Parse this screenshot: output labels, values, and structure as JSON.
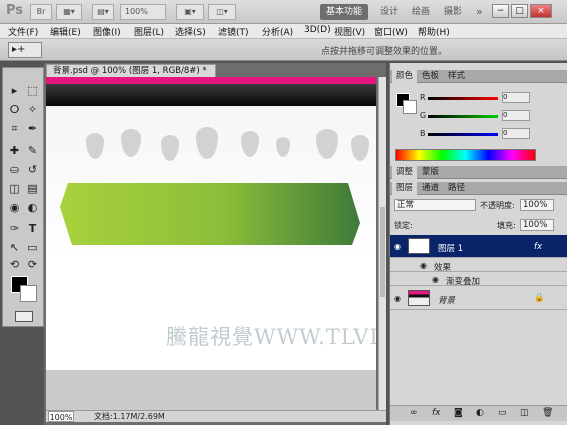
{
  "app": {
    "logo": "Ps",
    "zoom_level": "100%",
    "workspaces": [
      "基本功能",
      "设计",
      "绘画",
      "摄影"
    ],
    "more": "»",
    "window_buttons": [
      "−",
      "□",
      "×"
    ]
  },
  "menu": [
    "文件(F)",
    "编辑(E)",
    "图像(I)",
    "图层(L)",
    "选择(S)",
    "滤镜(T)",
    "分析(A)",
    "3D(D)",
    "视图(V)",
    "窗口(W)",
    "帮助(H)"
  ],
  "options": {
    "tool_icon": "▸+",
    "hint": "点按并拖移可调整效果的位置。"
  },
  "tools": {
    "icons": [
      "move-icon",
      "marquee-icon",
      "lasso-icon",
      "quick-select-icon",
      "crop-icon",
      "eyedropper-icon",
      "healing-icon",
      "brush-icon",
      "stamp-icon",
      "history-brush-icon",
      "eraser-icon",
      "gradient-icon",
      "blur-icon",
      "dodge-icon",
      "pen-icon",
      "type-icon",
      "path-select-icon",
      "shape-icon",
      "3d-rotate-icon",
      "3d-orbit-icon",
      "hand-icon",
      "zoom-icon"
    ],
    "glyphs": [
      "▸",
      "⬚",
      "ⵔ",
      "✧",
      "⌗",
      "✒",
      "✚",
      "✎",
      "⛀",
      "↺",
      "◫",
      "▤",
      "◉",
      "◐",
      "✑",
      "T",
      "↖",
      "▭",
      "⟲",
      "⟳",
      "✋",
      "🔍"
    ]
  },
  "document": {
    "tab_title": "背景.psd @ 100% (图层 1, RGB/8#) *",
    "close": "×",
    "zoom": "100%",
    "doc_info": "文档:1.17M/2.69M",
    "watermark": "騰龍視覺WWW.TLVI.NET"
  },
  "color_panel": {
    "tabs": [
      "颜色",
      "色板",
      "样式"
    ],
    "channels": [
      {
        "label": "R",
        "value": "0",
        "color": "#cc0000"
      },
      {
        "label": "G",
        "value": "0",
        "color": "#00a000"
      },
      {
        "label": "B",
        "value": "0",
        "color": "#0000cc"
      }
    ]
  },
  "adjust_panel": {
    "tabs": [
      "调整",
      "蒙版"
    ]
  },
  "layers_panel": {
    "tabs": [
      "图层",
      "通道",
      "路径"
    ],
    "blend_mode": "正常",
    "opacity_label": "不透明度:",
    "opacity": "100%",
    "lock_label": "锁定:",
    "fill_label": "填充:",
    "fill": "100%",
    "layers": [
      {
        "name": "图层 1",
        "selected": true,
        "fx": "fx"
      },
      {
        "name": "效果",
        "sub": true
      },
      {
        "name": "渐变叠加",
        "sub": true
      },
      {
        "name": "背景",
        "locked": true
      }
    ],
    "footer_icons": [
      "link-icon",
      "fx-icon",
      "mask-icon",
      "adjust-icon",
      "folder-icon",
      "new-layer-icon",
      "trash-icon"
    ],
    "footer_glyphs": [
      "∞",
      "fx",
      "◙",
      "◐",
      "▭",
      "◫",
      "🗑"
    ]
  },
  "colors": {
    "accent": "#e6157f",
    "layer_selected": "#0a246a",
    "green_start": "#a8d23c",
    "green_end": "#3e7a39"
  }
}
